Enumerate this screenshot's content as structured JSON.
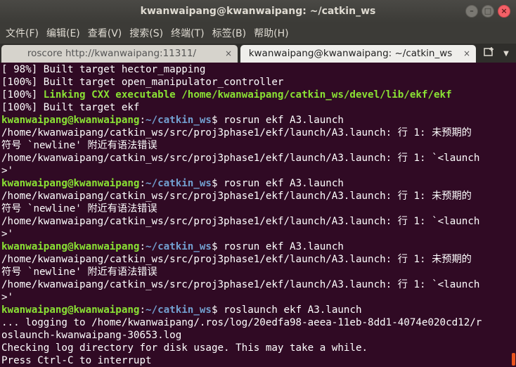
{
  "window": {
    "title": "kwanwaipang@kwanwaipang: ~/catkin_ws"
  },
  "menu": [
    "文件(F)",
    "编辑(E)",
    "查看(V)",
    "搜索(S)",
    "终端(T)",
    "标签(B)",
    "帮助(H)"
  ],
  "tabs": [
    {
      "label": "roscore http://kwanwaipang:11311/",
      "close": "×"
    },
    {
      "label": "kwanwaipang@kwanwaipang: ~/catkin_ws",
      "close": "×"
    }
  ],
  "colors": {
    "terminal_bg": "#300a24",
    "prompt_user": "#8ae234",
    "prompt_path": "#729fcf",
    "accent": "#e95420"
  },
  "prompt": {
    "user": "kwanwaipang@kwanwaipang",
    "path": "~/catkin_ws",
    "symbol": "$ "
  },
  "lines": [
    {
      "type": "text",
      "text": "[ 98%] Built target hector_mapping"
    },
    {
      "type": "text",
      "text": "[100%] Built target open_manipulator_controller"
    },
    {
      "type": "link",
      "prefix": "[100%] ",
      "text": "Linking CXX executable /home/kwanwaipang/catkin_ws/devel/lib/ekf/ekf"
    },
    {
      "type": "text",
      "text": "[100%] Built target ekf"
    },
    {
      "type": "cmd",
      "text": "rosrun ekf A3.launch"
    },
    {
      "type": "text",
      "text": "/home/kwanwaipang/catkin_ws/src/proj3phase1/ekf/launch/A3.launch: 行 1: 未预期的"
    },
    {
      "type": "text",
      "text": "符号 `newline' 附近有语法错误"
    },
    {
      "type": "text",
      "text": "/home/kwanwaipang/catkin_ws/src/proj3phase1/ekf/launch/A3.launch: 行 1: `<launch"
    },
    {
      "type": "text",
      "text": ">'"
    },
    {
      "type": "cmd",
      "text": "rosrun ekf A3.launch"
    },
    {
      "type": "text",
      "text": "/home/kwanwaipang/catkin_ws/src/proj3phase1/ekf/launch/A3.launch: 行 1: 未预期的"
    },
    {
      "type": "text",
      "text": "符号 `newline' 附近有语法错误"
    },
    {
      "type": "text",
      "text": "/home/kwanwaipang/catkin_ws/src/proj3phase1/ekf/launch/A3.launch: 行 1: `<launch"
    },
    {
      "type": "text",
      "text": ">'"
    },
    {
      "type": "cmd",
      "text": "rosrun ekf A3.launch"
    },
    {
      "type": "text",
      "text": "/home/kwanwaipang/catkin_ws/src/proj3phase1/ekf/launch/A3.launch: 行 1: 未预期的"
    },
    {
      "type": "text",
      "text": "符号 `newline' 附近有语法错误"
    },
    {
      "type": "text",
      "text": "/home/kwanwaipang/catkin_ws/src/proj3phase1/ekf/launch/A3.launch: 行 1: `<launch"
    },
    {
      "type": "text",
      "text": ">'"
    },
    {
      "type": "cmd",
      "text": "roslaunch ekf A3.launch"
    },
    {
      "type": "text",
      "text": "... logging to /home/kwanwaipang/.ros/log/20edfa98-aeea-11eb-8dd1-4074e020cd12/r"
    },
    {
      "type": "text",
      "text": "oslaunch-kwanwaipang-30653.log"
    },
    {
      "type": "text",
      "text": "Checking log directory for disk usage. This may take a while."
    },
    {
      "type": "text",
      "text": "Press Ctrl-C to interrupt"
    }
  ]
}
